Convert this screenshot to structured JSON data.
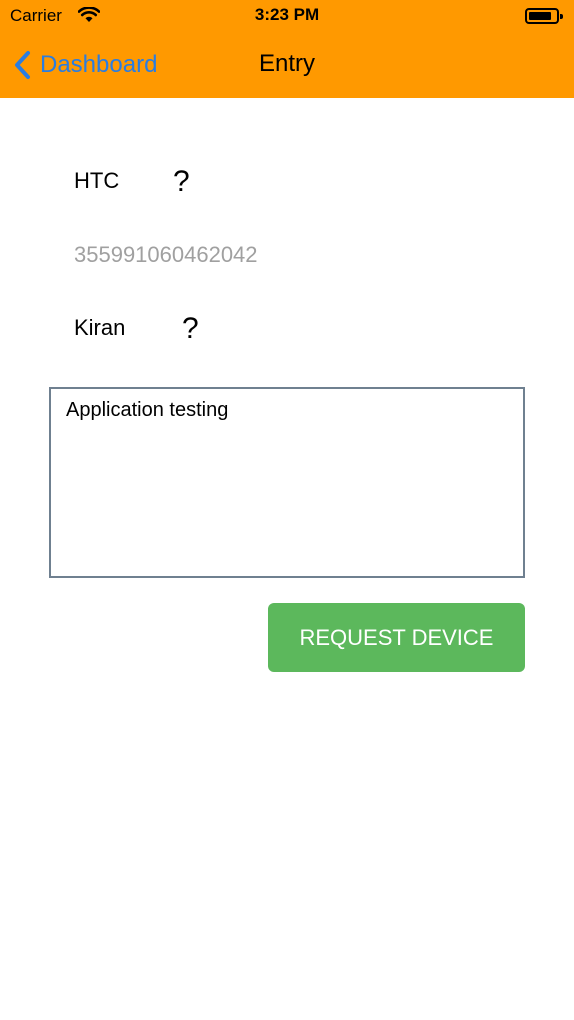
{
  "status_bar": {
    "carrier": "Carrier",
    "time": "3:23 PM"
  },
  "nav": {
    "back_label": "Dashboard",
    "title": "Entry"
  },
  "form": {
    "device_name": "HTC",
    "device_help": "?",
    "imei": "355991060462042",
    "user_name": "Kiran",
    "user_help": "?",
    "purpose": "Application testing",
    "request_button": "REQUEST DEVICE"
  },
  "colors": {
    "nav_background": "#ff9900",
    "back_link": "#2a7de1",
    "button": "#5cb85c",
    "imei_text": "#a0a0a0"
  },
  "icons": {
    "back": "chevron-left-icon",
    "wifi": "wifi-icon",
    "battery": "battery-icon"
  }
}
